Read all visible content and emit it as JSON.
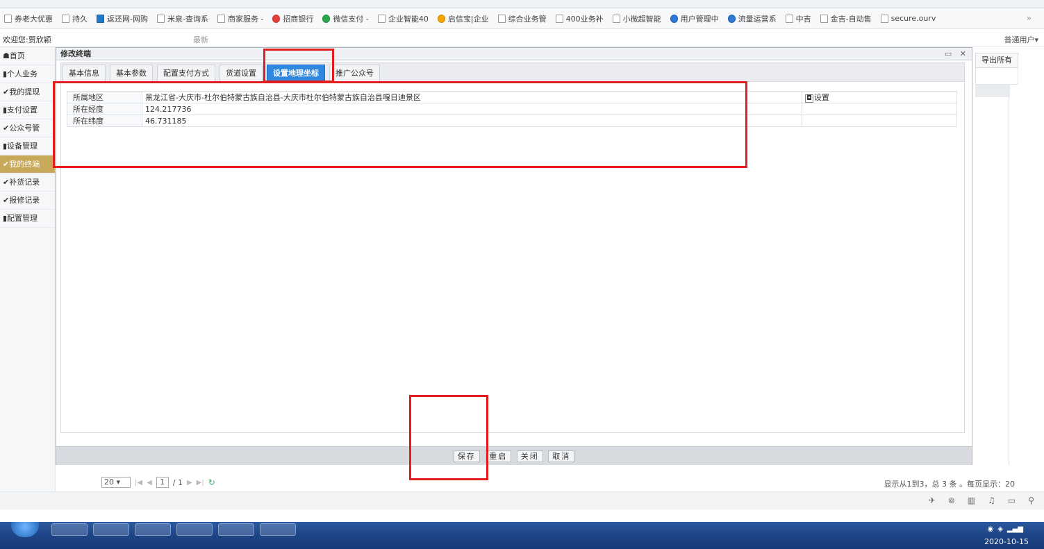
{
  "bookmarks": [
    {
      "label": "券老大优惠",
      "icon": "page-icon"
    },
    {
      "label": "持久",
      "icon": "page-icon"
    },
    {
      "label": "返还网-网购",
      "icon": "rebate-icon"
    },
    {
      "label": "米泉-查询系",
      "icon": "page-icon"
    },
    {
      "label": "商家服务 -",
      "icon": "page-icon"
    },
    {
      "label": "招商银行",
      "icon": "bank-icon"
    },
    {
      "label": "微信支付 -",
      "icon": "wechat-icon"
    },
    {
      "label": "企业智能40",
      "icon": "page-icon"
    },
    {
      "label": "启信宝|企业",
      "icon": "shield-icon"
    },
    {
      "label": "综合业务管",
      "icon": "page-icon"
    },
    {
      "label": "400业务补",
      "icon": "page-icon"
    },
    {
      "label": "小微超智能",
      "icon": "page-icon"
    },
    {
      "label": "用户管理中",
      "icon": "user-icon"
    },
    {
      "label": "流量运营系",
      "icon": "leaf-icon"
    },
    {
      "label": "中吉",
      "icon": "page-icon"
    },
    {
      "label": "金吉-自动售",
      "icon": "page-icon"
    },
    {
      "label": "secure.ourv",
      "icon": "page-icon"
    }
  ],
  "bookmarks_more": "»",
  "header": {
    "welcome": "欢迎您:贾欣颖",
    "mid_text": "最新",
    "user_menu": "普通用户▾"
  },
  "sidebar": {
    "items": [
      {
        "label": "☗首页"
      },
      {
        "label": "▮个人业务"
      },
      {
        "label": "✔我的提现"
      },
      {
        "label": "▮支付设置"
      },
      {
        "label": "✔公众号管"
      },
      {
        "label": "▮设备管理"
      },
      {
        "label": "✔我的终端",
        "active": true
      },
      {
        "label": "✔补货记录"
      },
      {
        "label": "✔报修记录"
      },
      {
        "label": "▮配置管理"
      }
    ]
  },
  "page": {
    "export_button": "导出所有"
  },
  "modal": {
    "title": "修改终端",
    "controls": "▭ ✕",
    "tabs": [
      {
        "label": "基本信息"
      },
      {
        "label": "基本参数"
      },
      {
        "label": "配置支付方式"
      },
      {
        "label": "货道设置"
      },
      {
        "label": "设置地理坐标",
        "active": true
      },
      {
        "label": "推广公众号"
      }
    ],
    "form": {
      "region_label": "所属地区",
      "region_value": "黑龙江省-大庆市-杜尔伯特蒙古族自治县-大庆市杜尔伯特蒙古族自治县嘎日迪景区",
      "set_button": "设置",
      "longitude_label": "所在经度",
      "longitude_value": "124.217736",
      "latitude_label": "所在纬度",
      "latitude_value": "46.731185"
    },
    "footer": {
      "save": "保存",
      "restart": "重启",
      "close": "关闭",
      "cancel": "取消"
    }
  },
  "pagination": {
    "page_size": "20 ▾",
    "first": "|◀",
    "prev": "◀",
    "current_page": "1",
    "total_pages": "/ 1",
    "next": "▶",
    "last": "▶|",
    "refresh": "↻",
    "info": "显示从1到3，总 3 条 。每页显示：20"
  },
  "tray": {
    "clock": "2020-10-15"
  },
  "colors": {
    "annotation": "#e11d1d",
    "active_tab": "#2f87e0",
    "sidebar_active": "#c8a95a",
    "taskbar": "#1e4688"
  }
}
